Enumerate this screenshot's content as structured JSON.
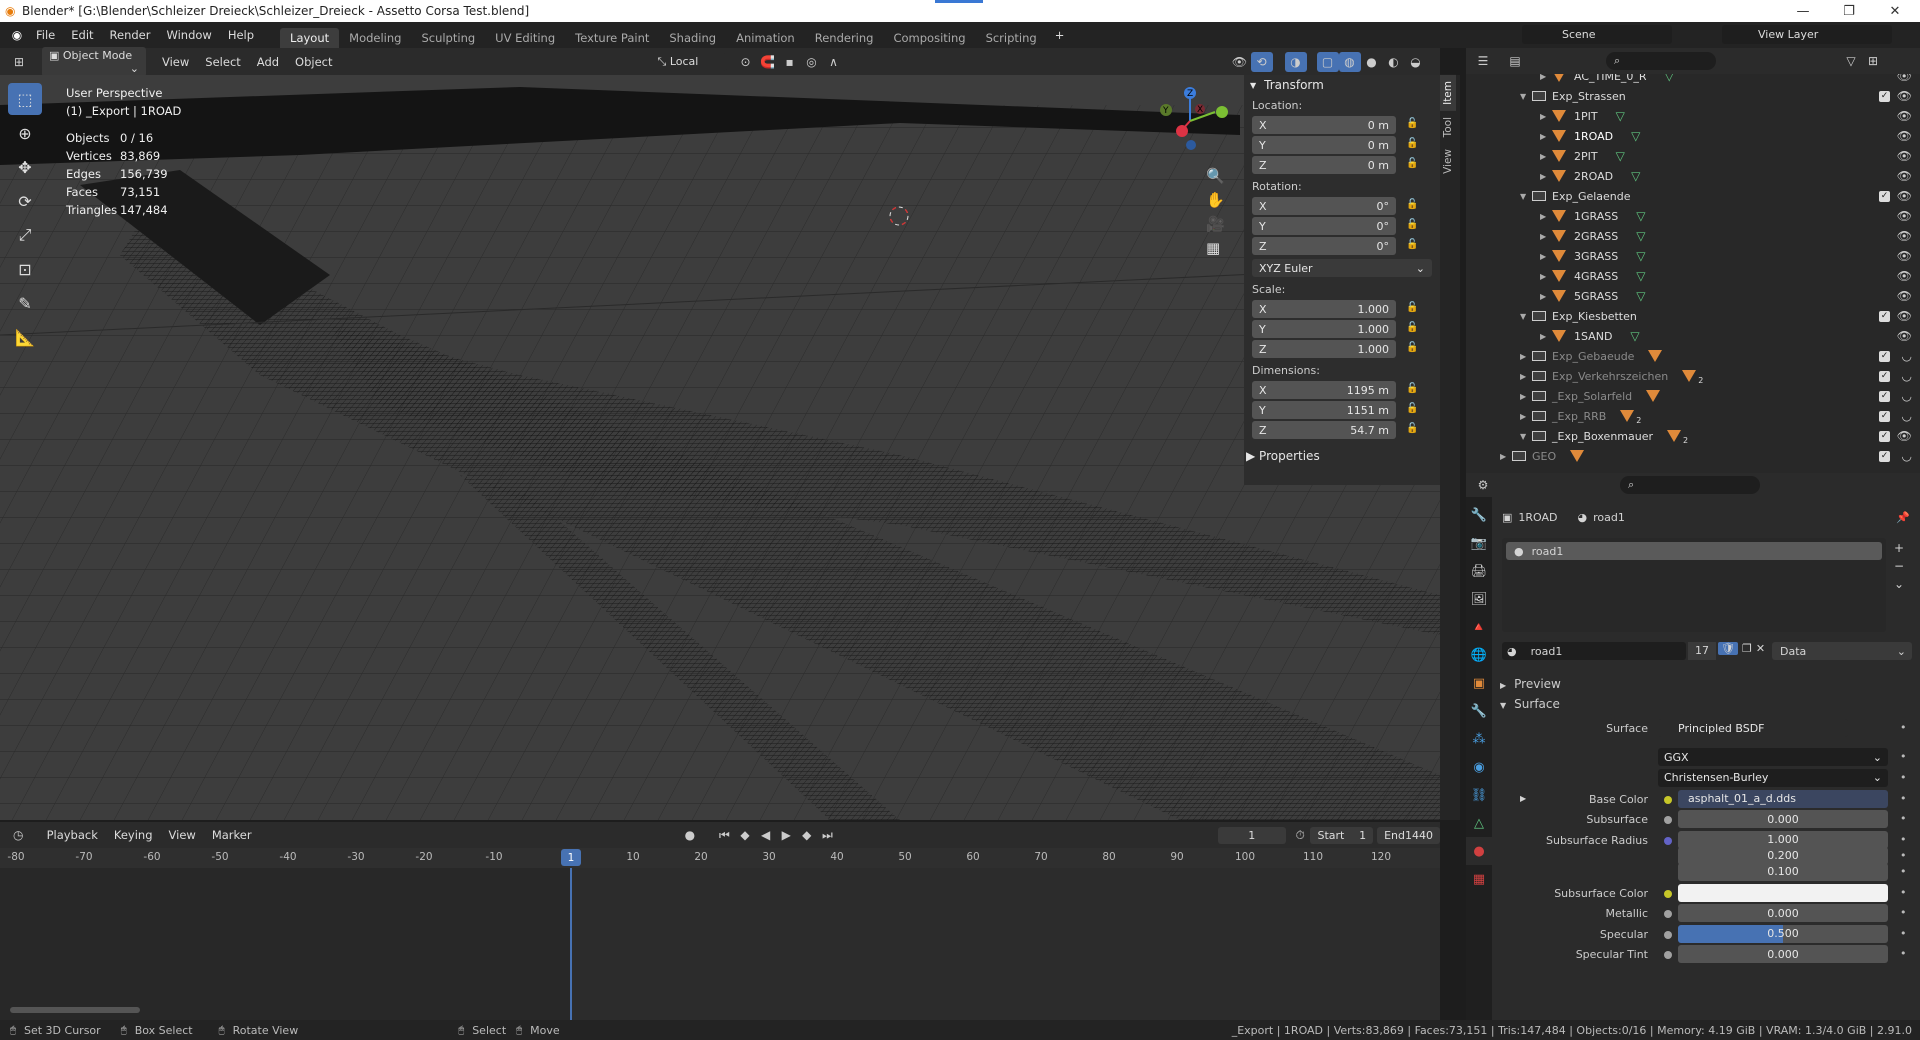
{
  "titlebar": {
    "title": "Blender* [G:\\Blender\\Schleizer Dreieck\\Schleizer_Dreieck - Assetto Corsa Test.blend]",
    "minimize": "—",
    "restore": "❐",
    "close": "✕"
  },
  "menu": {
    "items": [
      "File",
      "Edit",
      "Render",
      "Window",
      "Help"
    ],
    "workspaces": [
      "Layout",
      "Modeling",
      "Sculpting",
      "UV Editing",
      "Texture Paint",
      "Shading",
      "Animation",
      "Rendering",
      "Compositing",
      "Scripting"
    ],
    "add_tab": "+",
    "scene_label": "Scene",
    "view_layer_label": "View Layer"
  },
  "viewport_header": {
    "mode": "Object Mode",
    "menus": [
      "View",
      "Select",
      "Add",
      "Object"
    ],
    "orientation": "Local"
  },
  "overlay": {
    "line1": "User Perspective",
    "line2": "(1) _Export | 1ROAD"
  },
  "stats": [
    {
      "k": "Objects",
      "v": "0 / 16"
    },
    {
      "k": "Vertices",
      "v": "83,869"
    },
    {
      "k": "Edges",
      "v": "156,739"
    },
    {
      "k": "Faces",
      "v": "73,151"
    },
    {
      "k": "Triangles",
      "v": "147,484"
    }
  ],
  "gizmo": {
    "z": "Z",
    "y": "Y",
    "x": "X"
  },
  "npanel": {
    "header": "Transform",
    "location_label": "Location:",
    "location": [
      {
        "a": "X",
        "v": "0 m"
      },
      {
        "a": "Y",
        "v": "0 m"
      },
      {
        "a": "Z",
        "v": "0 m"
      }
    ],
    "rotation_label": "Rotation:",
    "rotation": [
      {
        "a": "X",
        "v": "0°"
      },
      {
        "a": "Y",
        "v": "0°"
      },
      {
        "a": "Z",
        "v": "0°"
      }
    ],
    "rotation_mode": "XYZ Euler",
    "scale_label": "Scale:",
    "scale": [
      {
        "a": "X",
        "v": "1.000"
      },
      {
        "a": "Y",
        "v": "1.000"
      },
      {
        "a": "Z",
        "v": "1.000"
      }
    ],
    "dimensions_label": "Dimensions:",
    "dimensions": [
      {
        "a": "X",
        "v": "1195 m"
      },
      {
        "a": "Y",
        "v": "1151 m"
      },
      {
        "a": "Z",
        "v": "54.7 m"
      }
    ],
    "properties": "Properties",
    "tabs": [
      "Item",
      "Tool",
      "View"
    ]
  },
  "timeline": {
    "menus": [
      "Playback",
      "Keying",
      "View",
      "Marker"
    ],
    "current_frame": "1",
    "start_label": "Start",
    "start": "1",
    "end_label": "End",
    "end": "1440",
    "ticks": [
      "-80",
      "-70",
      "-60",
      "-50",
      "-40",
      "-30",
      "-20",
      "-10",
      "1",
      "10",
      "20",
      "30",
      "40",
      "50",
      "60",
      "70",
      "80",
      "90",
      "100",
      "110",
      "120"
    ]
  },
  "outliner": {
    "rows": [
      {
        "name": "AC_TIME_0_R",
        "kind": "obj",
        "indent": 2,
        "dim": false,
        "badge": ""
      },
      {
        "name": "Exp_Strassen",
        "kind": "coll",
        "indent": 1,
        "dim": false,
        "badge": ""
      },
      {
        "name": "1PIT",
        "kind": "obj",
        "indent": 2,
        "dim": false,
        "badge": ""
      },
      {
        "name": "1ROAD",
        "kind": "obj",
        "indent": 2,
        "dim": false,
        "badge": ""
      },
      {
        "name": "2PIT",
        "kind": "obj",
        "indent": 2,
        "dim": false,
        "badge": ""
      },
      {
        "name": "2ROAD",
        "kind": "obj",
        "indent": 2,
        "dim": false,
        "badge": ""
      },
      {
        "name": "Exp_Gelaende",
        "kind": "coll",
        "indent": 1,
        "dim": false,
        "badge": ""
      },
      {
        "name": "1GRASS",
        "kind": "obj",
        "indent": 2,
        "dim": false,
        "badge": ""
      },
      {
        "name": "2GRASS",
        "kind": "obj",
        "indent": 2,
        "dim": false,
        "badge": ""
      },
      {
        "name": "3GRASS",
        "kind": "obj",
        "indent": 2,
        "dim": false,
        "badge": ""
      },
      {
        "name": "4GRASS",
        "kind": "obj",
        "indent": 2,
        "dim": false,
        "badge": ""
      },
      {
        "name": "5GRASS",
        "kind": "obj",
        "indent": 2,
        "dim": false,
        "badge": ""
      },
      {
        "name": "Exp_Kiesbetten",
        "kind": "coll",
        "indent": 1,
        "dim": false,
        "badge": ""
      },
      {
        "name": "1SAND",
        "kind": "obj",
        "indent": 2,
        "dim": false,
        "badge": ""
      },
      {
        "name": "Exp_Gebaeude",
        "kind": "coll",
        "indent": 1,
        "dim": true,
        "badge": ""
      },
      {
        "name": "Exp_Verkehrszeichen",
        "kind": "coll",
        "indent": 1,
        "dim": true,
        "badge": "2"
      },
      {
        "name": "_Exp_Solarfeld",
        "kind": "coll",
        "indent": 1,
        "dim": true,
        "badge": ""
      },
      {
        "name": "_Exp_RRB",
        "kind": "coll",
        "indent": 1,
        "dim": true,
        "badge": "2"
      },
      {
        "name": "_Exp_Boxenmauer",
        "kind": "coll",
        "indent": 1,
        "dim": false,
        "badge": "2"
      },
      {
        "name": "GEO",
        "kind": "coll",
        "indent": 0,
        "dim": true,
        "badge": ""
      }
    ]
  },
  "properties": {
    "object": "1ROAD",
    "material": "road1",
    "slot": "road1",
    "users": "17",
    "link": "Data",
    "preview": "Preview",
    "surface_header": "Surface",
    "rows": [
      {
        "label": "Surface",
        "value": "Principled BSDF",
        "type": "link",
        "dot": "#63c763"
      },
      {
        "label": "",
        "value": "GGX",
        "type": "select",
        "dot": ""
      },
      {
        "label": "",
        "value": "Christensen-Burley",
        "type": "select",
        "dot": ""
      },
      {
        "label": "Base Color",
        "value": "asphalt_01_a_d.dds",
        "type": "tex",
        "dot": "#c7c729"
      },
      {
        "label": "Subsurface",
        "value": "0.000",
        "type": "num",
        "dot": "#a1a1a1"
      },
      {
        "label": "Subsurface Radius",
        "value": "1.000",
        "type": "num",
        "dot": "#6363c7"
      },
      {
        "label": "",
        "value": "0.200",
        "type": "num",
        "dot": ""
      },
      {
        "label": "",
        "value": "0.100",
        "type": "num",
        "dot": ""
      },
      {
        "label": "Subsurface Color",
        "value": "",
        "type": "color",
        "dot": "#c7c729"
      },
      {
        "label": "Metallic",
        "value": "0.000",
        "type": "num",
        "dot": "#a1a1a1"
      },
      {
        "label": "Specular",
        "value": "0.500",
        "type": "slider",
        "dot": "#a1a1a1"
      },
      {
        "label": "Specular Tint",
        "value": "0.000",
        "type": "num",
        "dot": "#a1a1a1"
      }
    ]
  },
  "statusbar": {
    "items": [
      "Set 3D Cursor",
      "Box Select",
      "Rotate View",
      "Select",
      "Move"
    ],
    "info": "_Export | 1ROAD | Verts:83,869 | Faces:73,151 | Tris:147,484 | Objects:0/16 | Memory: 4.19 GiB | VRAM: 1.3/4.0 GiB | 2.91.0"
  },
  "colors": {
    "accent": "#4772b3",
    "mesh": "#5fc47f",
    "object": "#e08a3a"
  }
}
